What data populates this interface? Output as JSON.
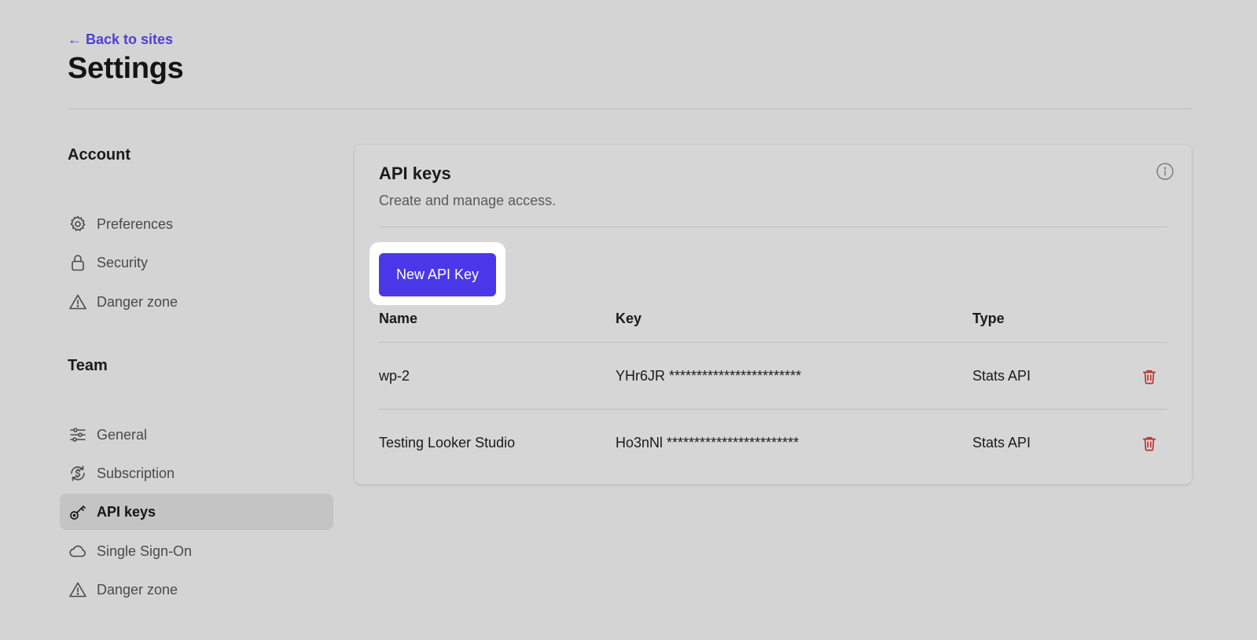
{
  "header": {
    "back_label": "← Back to sites",
    "title": "Settings"
  },
  "sidebar": {
    "account_heading": "Account",
    "account_items": [
      {
        "label": "Preferences",
        "icon": "gear-icon"
      },
      {
        "label": "Security",
        "icon": "lock-icon"
      },
      {
        "label": "Danger zone",
        "icon": "warning-icon"
      }
    ],
    "team_heading": "Team",
    "team_items": [
      {
        "label": "General",
        "icon": "sliders-icon"
      },
      {
        "label": "Subscription",
        "icon": "dollar-cycle-icon"
      },
      {
        "label": "API keys",
        "icon": "key-icon",
        "active": true
      },
      {
        "label": "Single Sign-On",
        "icon": "cloud-icon"
      },
      {
        "label": "Danger zone",
        "icon": "warning-icon"
      }
    ]
  },
  "card": {
    "title": "API keys",
    "subtitle": "Create and manage access.",
    "new_button": "New API Key",
    "columns": [
      "Name",
      "Key",
      "Type"
    ],
    "rows": [
      {
        "name": "wp-2",
        "key": "YHr6JR ************************",
        "type": "Stats API"
      },
      {
        "name": "Testing Looker Studio",
        "key": "Ho3nNl ************************",
        "type": "Stats API"
      }
    ]
  },
  "colors": {
    "accent": "#4a38e8",
    "link": "#4f3fd6",
    "danger": "#c0302c",
    "background": "#d4d4d4"
  }
}
